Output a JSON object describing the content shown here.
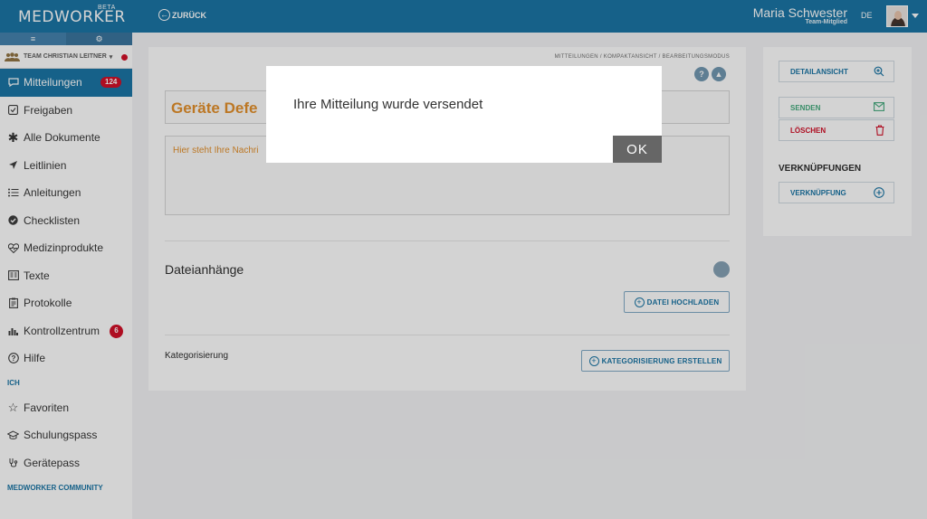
{
  "header": {
    "logo": "MEDWORKER",
    "logo_badge": "BETA",
    "back_label": "ZURÜCK",
    "user_name": "Maria Schwester",
    "user_role": "Team-Mitglied",
    "language": "DE"
  },
  "sidebar": {
    "tab_icons": [
      "menu-icon",
      "settings-icon"
    ],
    "team_label": "TEAM CHRISTIAN LEITNER",
    "items": [
      {
        "label": "Mitteilungen",
        "icon": "chat-icon",
        "badge": "124"
      },
      {
        "label": "Freigaben",
        "icon": "check-square-icon"
      },
      {
        "label": "Alle Dokumente",
        "icon": "asterisk-icon"
      },
      {
        "label": "Leitlinien",
        "icon": "arrow-icon"
      },
      {
        "label": "Anleitungen",
        "icon": "list-icon"
      },
      {
        "label": "Checklisten",
        "icon": "check-circle-icon"
      },
      {
        "label": "Medizinprodukte",
        "icon": "heart-pulse-icon"
      },
      {
        "label": "Texte",
        "icon": "document-icon"
      },
      {
        "label": "Protokolle",
        "icon": "clipboard-icon"
      },
      {
        "label": "Kontrollzentrum",
        "icon": "bar-chart-icon",
        "badge": "6"
      },
      {
        "label": "Hilfe",
        "icon": "help-icon"
      }
    ],
    "section_ich": "ICH",
    "ich_items": [
      {
        "label": "Favoriten",
        "icon": "star-icon"
      },
      {
        "label": "Schulungspass",
        "icon": "graduation-icon"
      },
      {
        "label": "Gerätepass",
        "icon": "stethoscope-icon"
      }
    ],
    "section_community": "MEDWORKER COMMUNITY"
  },
  "main": {
    "breadcrumb": "MITTEILUNGEN / KOMPAKTANSICHT / BEARBEITUNGSMODUS",
    "title": "Geräte Defe",
    "message_placeholder": "Hier steht Ihre Nachri",
    "attachments_title": "Dateianhänge",
    "upload_button": "DATEI HOCHLADEN",
    "categorization_label": "Kategorisierung",
    "create_categorization_button": "KATEGORISIERUNG ERSTELLEN"
  },
  "right": {
    "detail_button": "DETAILANSICHT",
    "send_button": "SENDEN",
    "delete_button": "LÖSCHEN",
    "links_title": "VERKNÜPFUNGEN",
    "link_button": "VERKNÜPFUNG"
  },
  "dialog": {
    "message": "Ihre Mitteilung wurde versendet",
    "ok_label": "OK"
  },
  "colors": {
    "brand": "#0e6ea0",
    "badge": "#d0021b",
    "title_accent": "#e28a1f",
    "send": "#3aa676",
    "delete": "#d0021b"
  }
}
